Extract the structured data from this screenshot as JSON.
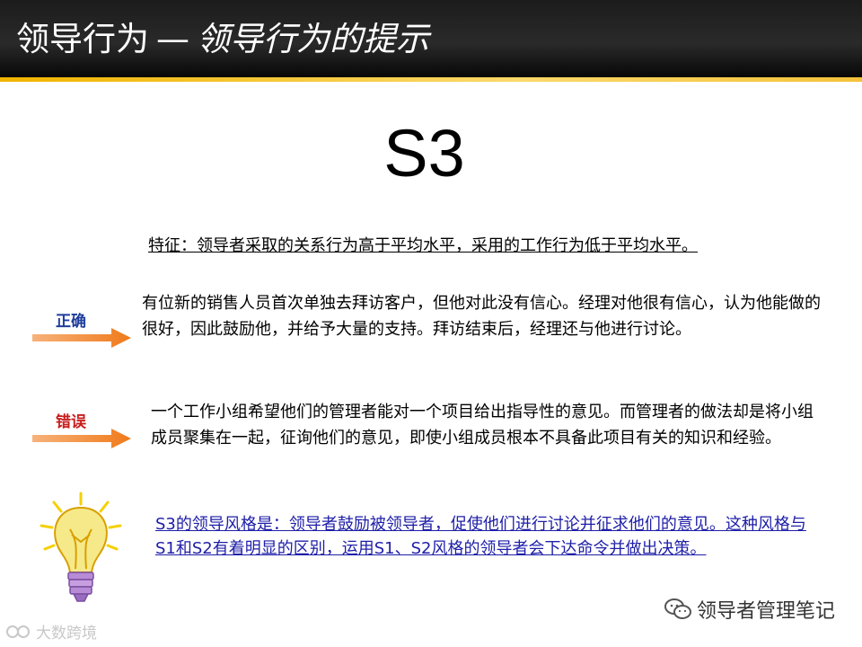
{
  "title": {
    "main": "领导行为",
    "separator": "—",
    "subtitle": "领导行为的提示"
  },
  "heading": "S3",
  "feature": "特征：领导者采取的关系行为高于平均水平，采用的工作行为低于平均水平。",
  "correct": {
    "label": "正确",
    "text": "有位新的销售人员首次单独去拜访客户，但他对此没有信心。经理对他很有信心，认为他能做的很好，因此鼓励他，并给予大量的支持。拜访结束后，经理还与他进行讨论。"
  },
  "wrong": {
    "label": "错误",
    "text": "一个工作小组希望他们的管理者能对一个项目给出指导性的意见。而管理者的做法却是将小组成员聚集在一起，征询他们的意见，即使小组成员根本不具备此项目有关的知识和经验。"
  },
  "tip": {
    "text": "S3的领导风格是：领导者鼓励被领导者，促使他们进行讨论并征求他们的意见。这种风格与S1和S2有着明显的区别，运用S1、S2风格的领导者会下达命令并做出决策。",
    "icon": "lightbulb-icon"
  },
  "watermark": {
    "text": "领导者管理笔记",
    "icon": "wechat-icon"
  },
  "corner_mark": {
    "text": "大数跨境",
    "icon": "corner-logo-icon"
  },
  "colors": {
    "title_bar": "#1c1c1c",
    "stripe": "#f0b400",
    "correct_label": "#1f3d9c",
    "wrong_label": "#c81e1e",
    "arrow": "#f07a1a",
    "tip_text": "#1e1ea8"
  }
}
